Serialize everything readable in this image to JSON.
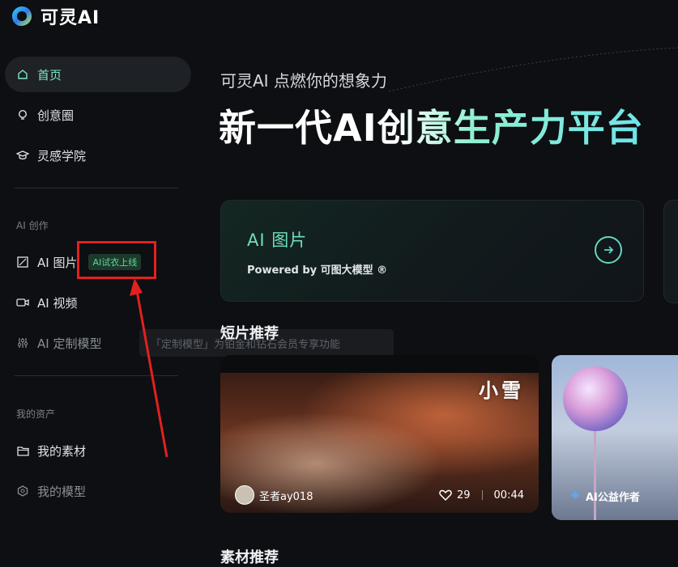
{
  "app": {
    "name": "可灵AI"
  },
  "sidebar": {
    "items": [
      {
        "label": "首页",
        "icon": "home-icon",
        "active": true
      },
      {
        "label": "创意圈",
        "icon": "lightbulb-icon"
      },
      {
        "label": "灵感学院",
        "icon": "graduation-cap-icon"
      }
    ],
    "section_creation": "AI 创作",
    "creation_items": [
      {
        "label": "AI 图片",
        "icon": "image-icon",
        "badge": "AI试衣上线"
      },
      {
        "label": "AI 视频",
        "icon": "video-camera-icon"
      },
      {
        "label": "AI 定制模型",
        "icon": "sliders-icon"
      }
    ],
    "section_assets": "我的资产",
    "asset_items": [
      {
        "label": "我的素材",
        "icon": "folder-icon"
      },
      {
        "label": "我的模型",
        "icon": "model-hex-icon"
      }
    ],
    "tooltip": "「定制模型」为铂金和钻石会员专享功能"
  },
  "hero": {
    "subtitle": "可灵AI 点燃你的想象力",
    "title": "新一代AI创意生产力平台"
  },
  "feature_card": {
    "title": "AI 图片",
    "powered_by": "Powered by 可图大模型 ®"
  },
  "short_videos": {
    "title": "短片推荐",
    "items": [
      {
        "overlay_text": "小雪",
        "author": "圣者ay018",
        "likes": "29",
        "duration": "00:44"
      },
      {
        "author": "AI公益作者"
      }
    ]
  },
  "materials": {
    "title": "素材推荐"
  },
  "colors": {
    "accent": "#6fe0bd",
    "background": "#0d0f12",
    "annotation_red": "#e32020"
  }
}
